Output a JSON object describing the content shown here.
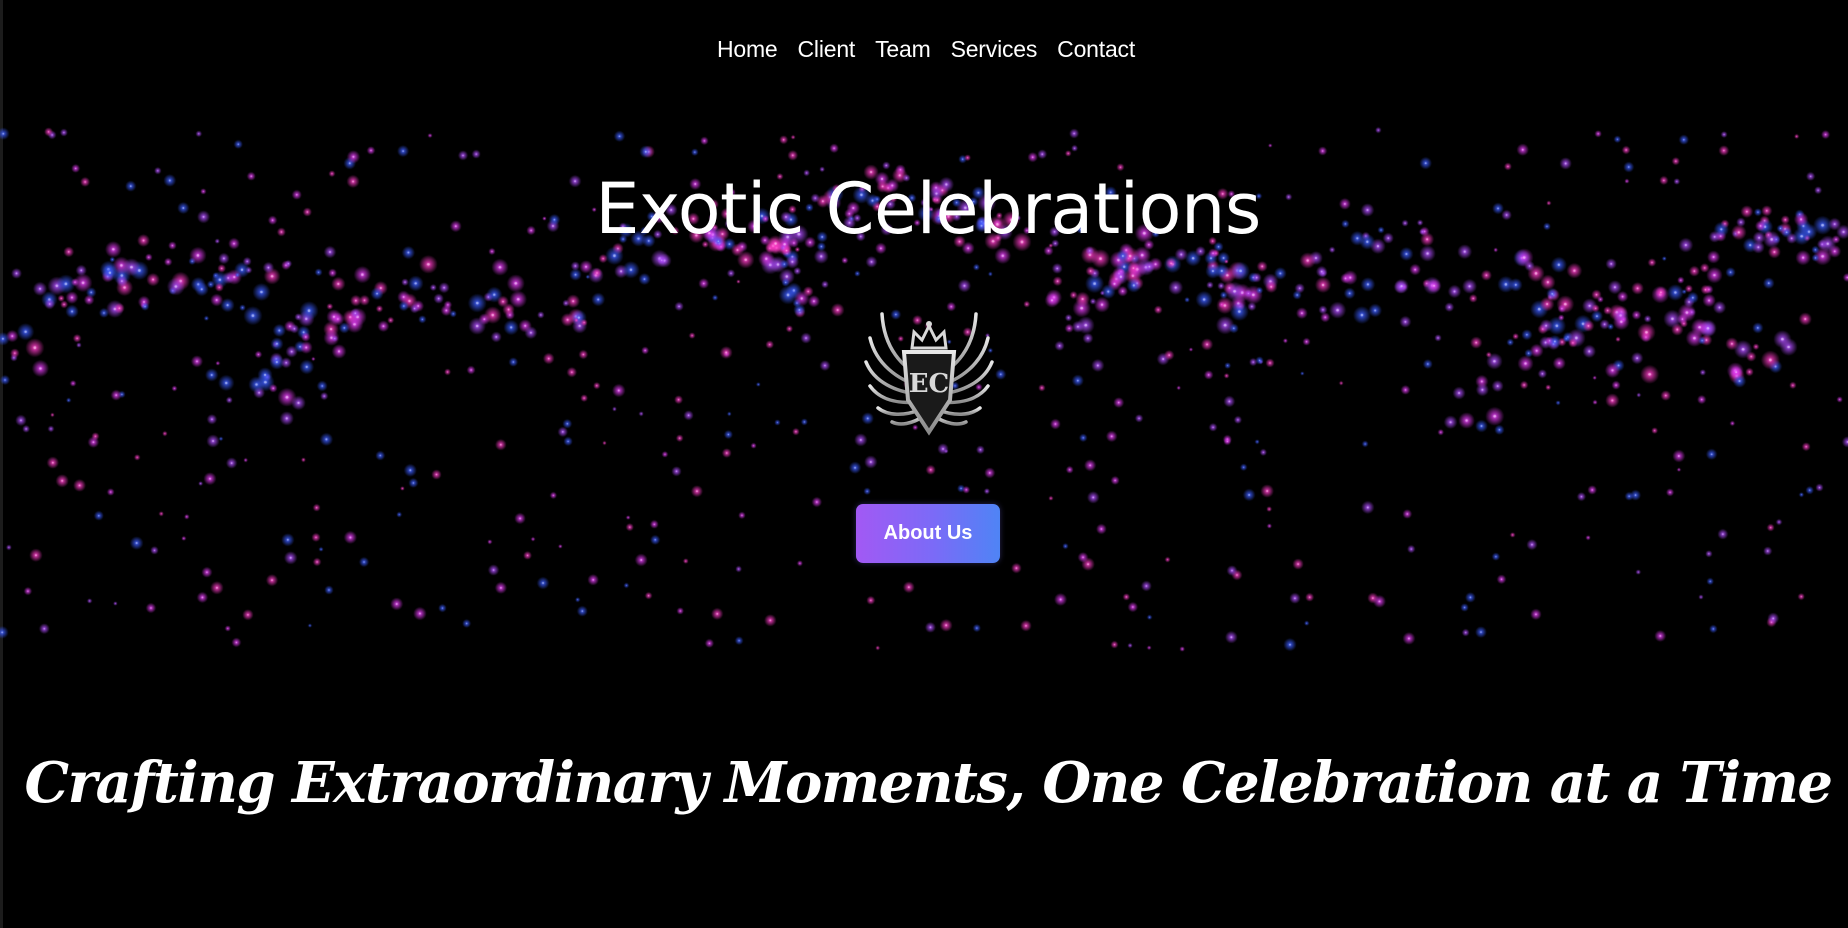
{
  "nav": {
    "items": [
      {
        "label": "Home"
      },
      {
        "label": "Client"
      },
      {
        "label": "Team"
      },
      {
        "label": "Services"
      },
      {
        "label": "Contact"
      }
    ]
  },
  "hero": {
    "title": "Exotic Celebrations",
    "logo_icon": "winged-crown-crest-icon",
    "logo_monogram": "EC",
    "button_label": "About Us",
    "button_gradient": [
      "#a259f4",
      "#4f84f5"
    ]
  },
  "tagline": "Crafting Extraordinary Moments, One Celebration at a Time",
  "theme": {
    "background": "#000000",
    "particle_colors": [
      "#e43cf5",
      "#3c5cff",
      "#b04dff",
      "#ff3cc8"
    ]
  }
}
